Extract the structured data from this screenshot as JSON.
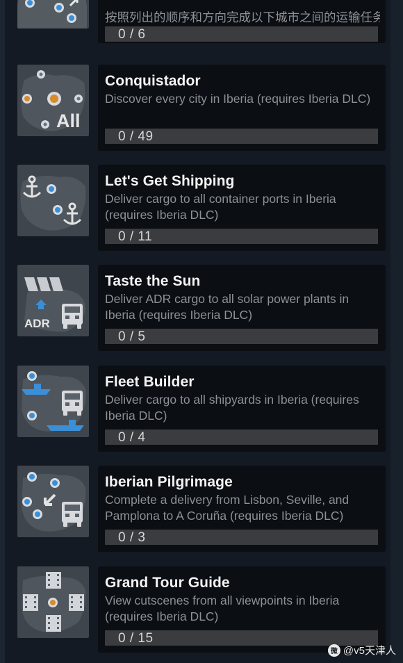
{
  "achievements": [
    {
      "title": "",
      "description": "按照列出的顺序和方向完成以下城市之间的运输任务：巴黎-斯特拉斯堡，斯特拉斯堡-莫尼",
      "progress": "0 / 6",
      "progress_value": 0,
      "icon": "map-route-icon"
    },
    {
      "title": "Conquistador",
      "description": "Discover every city in Iberia (requires Iberia DLC)",
      "progress": "0 / 49",
      "progress_value": 0,
      "icon": "map-all-cities-icon",
      "icon_text": "All"
    },
    {
      "title": "Let's Get Shipping",
      "description": "Deliver cargo to all container ports in Iberia (requires Iberia DLC)",
      "progress": "0 / 11",
      "progress_value": 0,
      "icon": "map-ports-anchor-icon"
    },
    {
      "title": "Taste the Sun",
      "description": "Deliver ADR cargo to all solar power plants in Iberia (requires Iberia DLC)",
      "progress": "0 / 5",
      "progress_value": 0,
      "icon": "solar-adr-truck-icon",
      "icon_text": "ADR"
    },
    {
      "title": "Fleet Builder",
      "description": "Deliver cargo to all shipyards in Iberia (requires Iberia DLC)",
      "progress": "0 / 4",
      "progress_value": 0,
      "icon": "map-ships-truck-icon"
    },
    {
      "title": "Iberian Pilgrimage",
      "description": "Complete a delivery from Lisbon, Seville, and Pamplona to A Coruña (requires Iberia DLC)",
      "progress": "0 / 3",
      "progress_value": 0,
      "icon": "map-cities-truck-icon"
    },
    {
      "title": "Grand Tour Guide",
      "description": "View cutscenes from all viewpoints in Iberia (requires Iberia DLC)",
      "progress": "0 / 15",
      "progress_value": 0,
      "icon": "map-viewpoints-film-icon"
    }
  ],
  "watermark": {
    "logo": "微",
    "text": "@v5天津人"
  },
  "colors": {
    "background": "#131a23",
    "panel": "#0b0e12",
    "thumb": "#3e454d",
    "dot_blue": "#3b8fd6",
    "dot_orange": "#d98a2b",
    "progress_track": "#3a3c3f"
  }
}
